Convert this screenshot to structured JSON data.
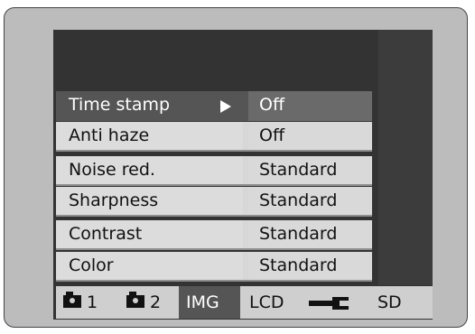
{
  "menu": {
    "rows": [
      {
        "label": "Time stamp",
        "value": "Off",
        "selected": true
      },
      {
        "label": "Anti haze",
        "value": "Off"
      },
      {
        "label": "Noise red.",
        "value": "Standard"
      },
      {
        "label": "Sharpness",
        "value": "Standard"
      },
      {
        "label": "Contrast",
        "value": "Standard"
      },
      {
        "label": "Color",
        "value": "Standard"
      }
    ]
  },
  "tabs": [
    {
      "label": "1",
      "icon": "camera-icon"
    },
    {
      "label": "2",
      "icon": "camera-icon"
    },
    {
      "label": "IMG",
      "active": true
    },
    {
      "label": "LCD"
    },
    {
      "label": "",
      "icon": "wrench-icon"
    },
    {
      "label": "SD"
    }
  ],
  "colors": {
    "selected": "#555555",
    "cell": "#d9d9d9",
    "screen": "#333333"
  }
}
